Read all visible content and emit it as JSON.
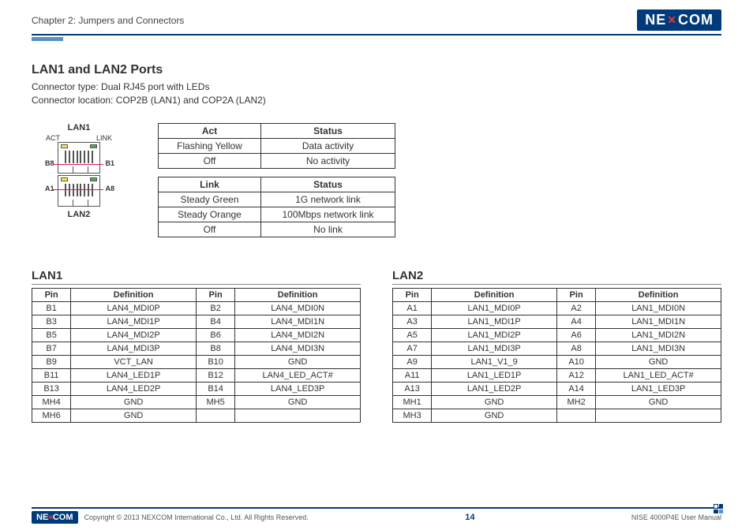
{
  "header": {
    "chapter": "Chapter 2: Jumpers and Connectors",
    "logo_text_1": "NE",
    "logo_text_2": "COM"
  },
  "section_title": "LAN1 and LAN2 Ports",
  "connector_type": "Connector type: Dual RJ45 port with LEDs",
  "connector_loc": "Connector location: COP2B (LAN1) and COP2A (LAN2)",
  "diagram": {
    "lan1_label": "LAN1",
    "lan2_label": "LAN2",
    "act_label": "ACT",
    "link_label": "LINK",
    "b8": "B8",
    "b1": "B1",
    "a1": "A1",
    "a8": "A8"
  },
  "act_table": {
    "headers": [
      "Act",
      "Status"
    ],
    "rows": [
      [
        "Flashing Yellow",
        "Data activity"
      ],
      [
        "Off",
        "No activity"
      ]
    ]
  },
  "link_table": {
    "headers": [
      "Link",
      "Status"
    ],
    "rows": [
      [
        "Steady Green",
        "1G network link"
      ],
      [
        "Steady Orange",
        "100Mbps network link"
      ],
      [
        "Off",
        "No link"
      ]
    ]
  },
  "lan1": {
    "title": "LAN1",
    "headers": [
      "Pin",
      "Definition",
      "Pin",
      "Definition"
    ],
    "rows": [
      [
        "B1",
        "LAN4_MDI0P",
        "B2",
        "LAN4_MDI0N"
      ],
      [
        "B3",
        "LAN4_MDI1P",
        "B4",
        "LAN4_MDI1N"
      ],
      [
        "B5",
        "LAN4_MDI2P",
        "B6",
        "LAN4_MDI2N"
      ],
      [
        "B7",
        "LAN4_MDI3P",
        "B8",
        "LAN4_MDI3N"
      ],
      [
        "B9",
        "VCT_LAN",
        "B10",
        "GND"
      ],
      [
        "B11",
        "LAN4_LED1P",
        "B12",
        "LAN4_LED_ACT#"
      ],
      [
        "B13",
        "LAN4_LED2P",
        "B14",
        "LAN4_LED3P"
      ],
      [
        "MH4",
        "GND",
        "MH5",
        "GND"
      ],
      [
        "MH6",
        "GND",
        "",
        ""
      ]
    ]
  },
  "lan2": {
    "title": "LAN2",
    "headers": [
      "Pin",
      "Definition",
      "Pin",
      "Definition"
    ],
    "rows": [
      [
        "A1",
        "LAN1_MDI0P",
        "A2",
        "LAN1_MDI0N"
      ],
      [
        "A3",
        "LAN1_MDI1P",
        "A4",
        "LAN1_MDI1N"
      ],
      [
        "A5",
        "LAN1_MDI2P",
        "A6",
        "LAN1_MDI2N"
      ],
      [
        "A7",
        "LAN1_MDI3P",
        "A8",
        "LAN1_MDI3N"
      ],
      [
        "A9",
        "LAN1_V1_9",
        "A10",
        "GND"
      ],
      [
        "A11",
        "LAN1_LED1P",
        "A12",
        "LAN1_LED_ACT#"
      ],
      [
        "A13",
        "LAN1_LED2P",
        "A14",
        "LAN1_LED3P"
      ],
      [
        "MH1",
        "GND",
        "MH2",
        "GND"
      ],
      [
        "MH3",
        "GND",
        "",
        ""
      ]
    ]
  },
  "footer": {
    "copyright": "Copyright © 2013 NEXCOM International Co., Ltd. All Rights Reserved.",
    "page": "14",
    "doc": "NISE 4000P4E User Manual"
  }
}
